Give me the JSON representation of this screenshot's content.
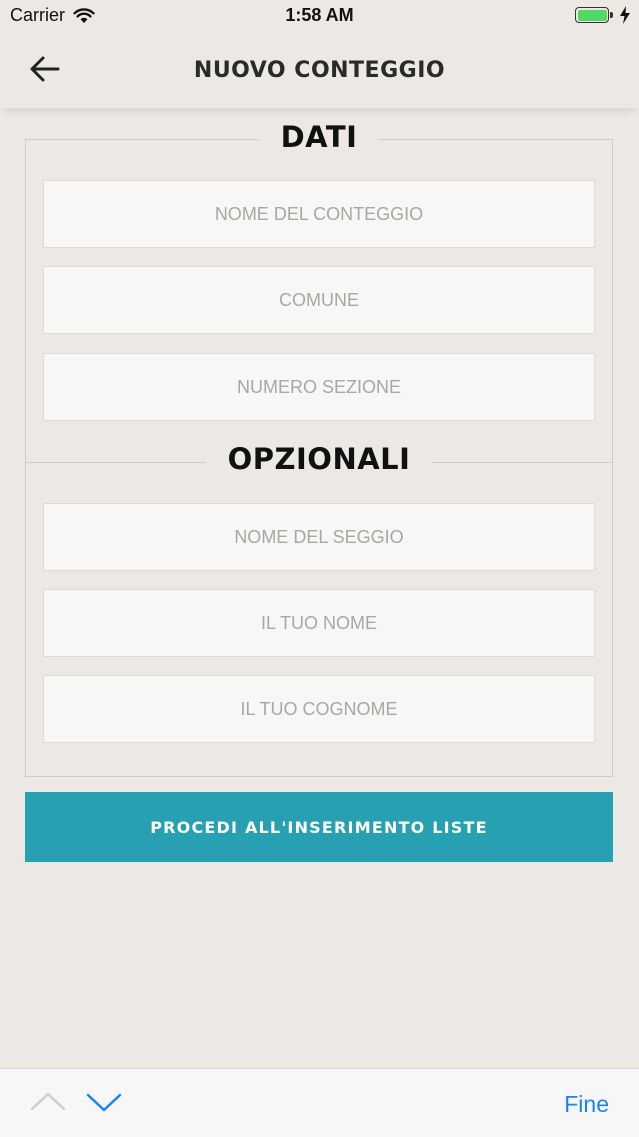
{
  "status_bar": {
    "carrier": "Carrier",
    "time": "1:58 AM"
  },
  "nav": {
    "title": "NUOVO CONTEGGIO"
  },
  "form": {
    "section_required": "DATI",
    "section_optional": "OPZIONALI",
    "fields": [
      {
        "placeholder": "NOME DEL CONTEGGIO",
        "value": ""
      },
      {
        "placeholder": "COMUNE",
        "value": ""
      },
      {
        "placeholder": "NUMERO SEZIONE",
        "value": ""
      },
      {
        "placeholder": "NOME DEL SEGGIO",
        "value": ""
      },
      {
        "placeholder": "IL TUO NOME",
        "value": ""
      },
      {
        "placeholder": "IL TUO COGNOME",
        "value": ""
      }
    ]
  },
  "primary_button": {
    "label": "PROCEDI ALL'INSERIMENTO LISTE"
  },
  "keyboard_toolbar": {
    "done_label": "Fine"
  },
  "colors": {
    "background": "#ece9e4",
    "accent": "#27a0b1",
    "link": "#1a85f0",
    "battery": "#4cd964"
  }
}
